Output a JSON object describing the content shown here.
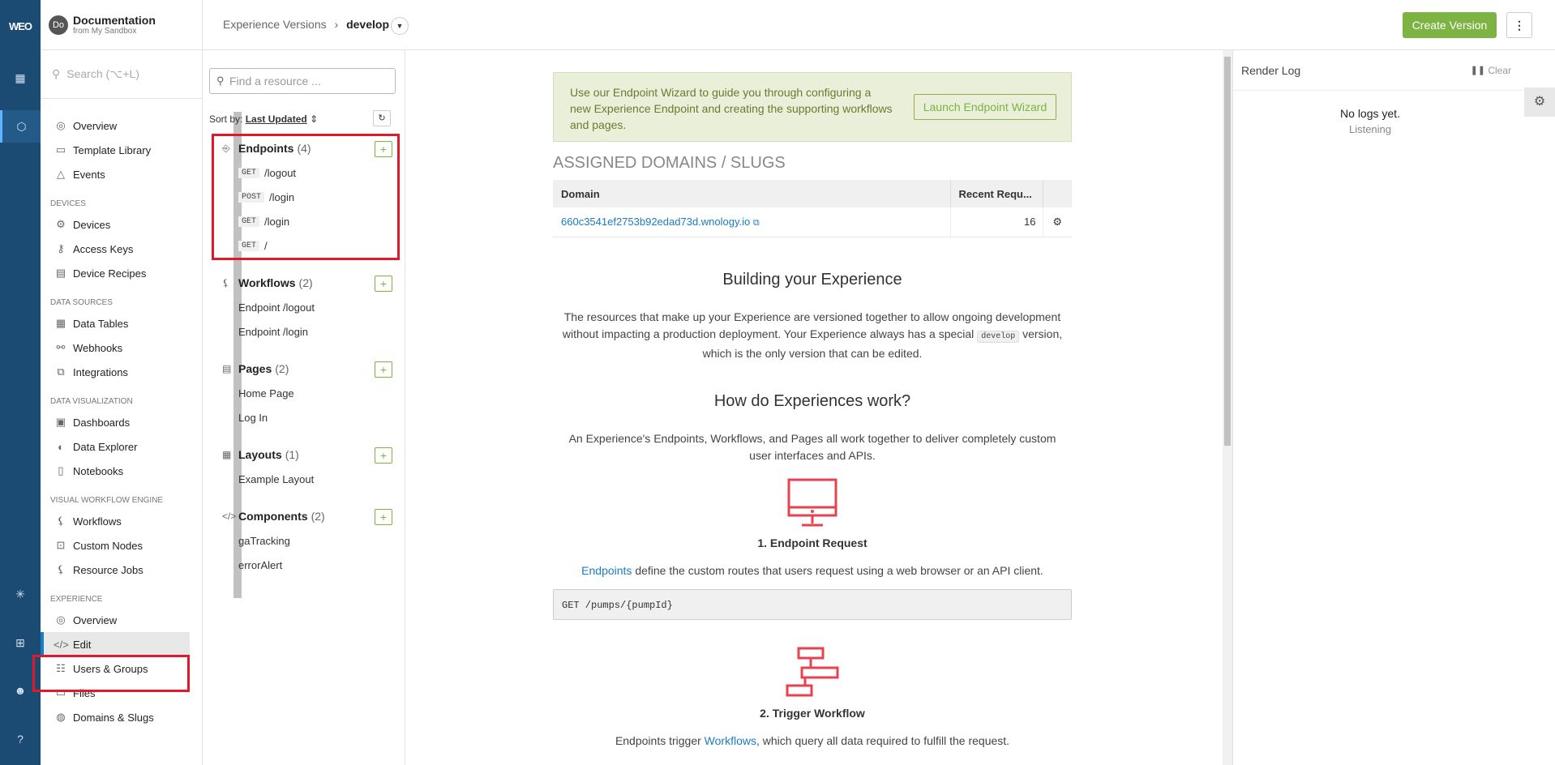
{
  "rail": {
    "logo": "WEO"
  },
  "sidebar": {
    "app_title": "Documentation",
    "app_subtitle": "from My Sandbox",
    "avatar_text": "Do",
    "search_placeholder": "Search (⌥+L)",
    "top_items": [
      "Overview",
      "Template Library",
      "Events"
    ],
    "sections": [
      {
        "title": "DEVICES",
        "items": [
          "Devices",
          "Access Keys",
          "Device Recipes"
        ]
      },
      {
        "title": "DATA SOURCES",
        "items": [
          "Data Tables",
          "Webhooks",
          "Integrations"
        ]
      },
      {
        "title": "DATA VISUALIZATION",
        "items": [
          "Dashboards",
          "Data Explorer",
          "Notebooks"
        ]
      },
      {
        "title": "VISUAL WORKFLOW ENGINE",
        "items": [
          "Workflows",
          "Custom Nodes",
          "Resource Jobs"
        ]
      },
      {
        "title": "EXPERIENCE",
        "items": [
          "Overview",
          "Edit",
          "Users & Groups",
          "Files",
          "Domains & Slugs"
        ]
      }
    ]
  },
  "header": {
    "breadcrumb_parent": "Experience Versions",
    "breadcrumb_sep": "›",
    "breadcrumb_current": "develop",
    "create_button": "Create Version"
  },
  "resources": {
    "find_placeholder": "Find a resource ...",
    "sort_label": "Sort by:",
    "sort_value": "Last Updated",
    "endpoints": {
      "title": "Endpoints",
      "count": "(4)",
      "items": [
        {
          "method": "GET",
          "path": "/logout"
        },
        {
          "method": "POST",
          "path": "/login"
        },
        {
          "method": "GET",
          "path": "/login"
        },
        {
          "method": "GET",
          "path": "/"
        }
      ]
    },
    "workflows": {
      "title": "Workflows",
      "count": "(2)",
      "items": [
        "Endpoint /logout",
        "Endpoint /login"
      ]
    },
    "pages": {
      "title": "Pages",
      "count": "(2)",
      "items": [
        "Home Page",
        "Log In"
      ]
    },
    "layouts": {
      "title": "Layouts",
      "count": "(1)",
      "items": [
        "Example Layout"
      ]
    },
    "components": {
      "title": "Components",
      "count": "(2)",
      "items": [
        "gaTracking",
        "errorAlert"
      ]
    }
  },
  "main": {
    "wizard_text": "Use our Endpoint Wizard to guide you through configuring a new Experience Endpoint and creating the supporting workflows and pages.",
    "wizard_button": "Launch Endpoint Wizard",
    "domains_heading": "ASSIGNED DOMAINS / SLUGS",
    "table_headers": [
      "Domain",
      "Recent Requ..."
    ],
    "table_rows": [
      {
        "domain": "660c3541ef2753b92edad73d.wnology.io",
        "requests": "16"
      }
    ],
    "building_title": "Building your Experience",
    "building_text_1": "The resources that make up your Experience are versioned together to allow ongoing development without impacting a production deployment. Your Experience always has a special",
    "building_code": "develop",
    "building_text_2": "version, which is the only version that can be edited.",
    "how_title": "How do Experiences work?",
    "how_text": "An Experience's Endpoints, Workflows, and Pages all work together to deliver completely custom user interfaces and APIs.",
    "step1_title": "1. Endpoint Request",
    "step1_link": "Endpoints",
    "step1_text": "define the custom routes that users request using a web browser or an API client.",
    "step1_code": "GET /pumps/{pumpId}",
    "step2_title": "2. Trigger Workflow",
    "step2_pre": "Endpoints trigger",
    "step2_link": "Workflows",
    "step2_text": ", which query all data required to fulfill the request."
  },
  "log": {
    "title": "Render Log",
    "clear": "Clear",
    "empty": "No logs yet.",
    "status": "Listening"
  },
  "colors": {
    "rail": "#1b4a72",
    "accent": "#7cb342",
    "highlight": "#e01a2b",
    "link": "#1b7bc4"
  }
}
